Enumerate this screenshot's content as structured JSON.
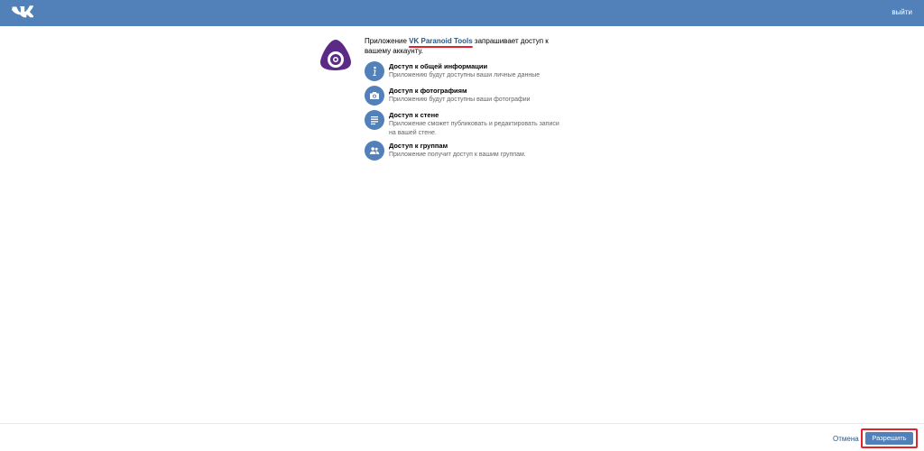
{
  "header": {
    "logout_label": "выйти",
    "colors": {
      "bar": "#5181b8"
    }
  },
  "request": {
    "prefix": "Приложение",
    "app_name": "VK Paranoid Tools",
    "suffix": "запрашивает доступ к вашему аккаунту."
  },
  "permissions": [
    {
      "icon": "info-icon",
      "title": "Доступ к общей информации",
      "description": "Приложению будут доступны ваши личные данные"
    },
    {
      "icon": "camera-icon",
      "title": "Доступ к фотографиям",
      "description": "Приложению будут доступны ваши фотографии"
    },
    {
      "icon": "list-icon",
      "title": "Доступ к стене",
      "description": "Приложение сможет публиковать и редактировать записи на вашей стене."
    },
    {
      "icon": "people-icon",
      "title": "Доступ к группам",
      "description": "Приложение получит доступ к вашим группам."
    }
  ],
  "footer": {
    "cancel_label": "Отмена",
    "allow_label": "Разрешить",
    "highlight_color": "#e0232c"
  }
}
